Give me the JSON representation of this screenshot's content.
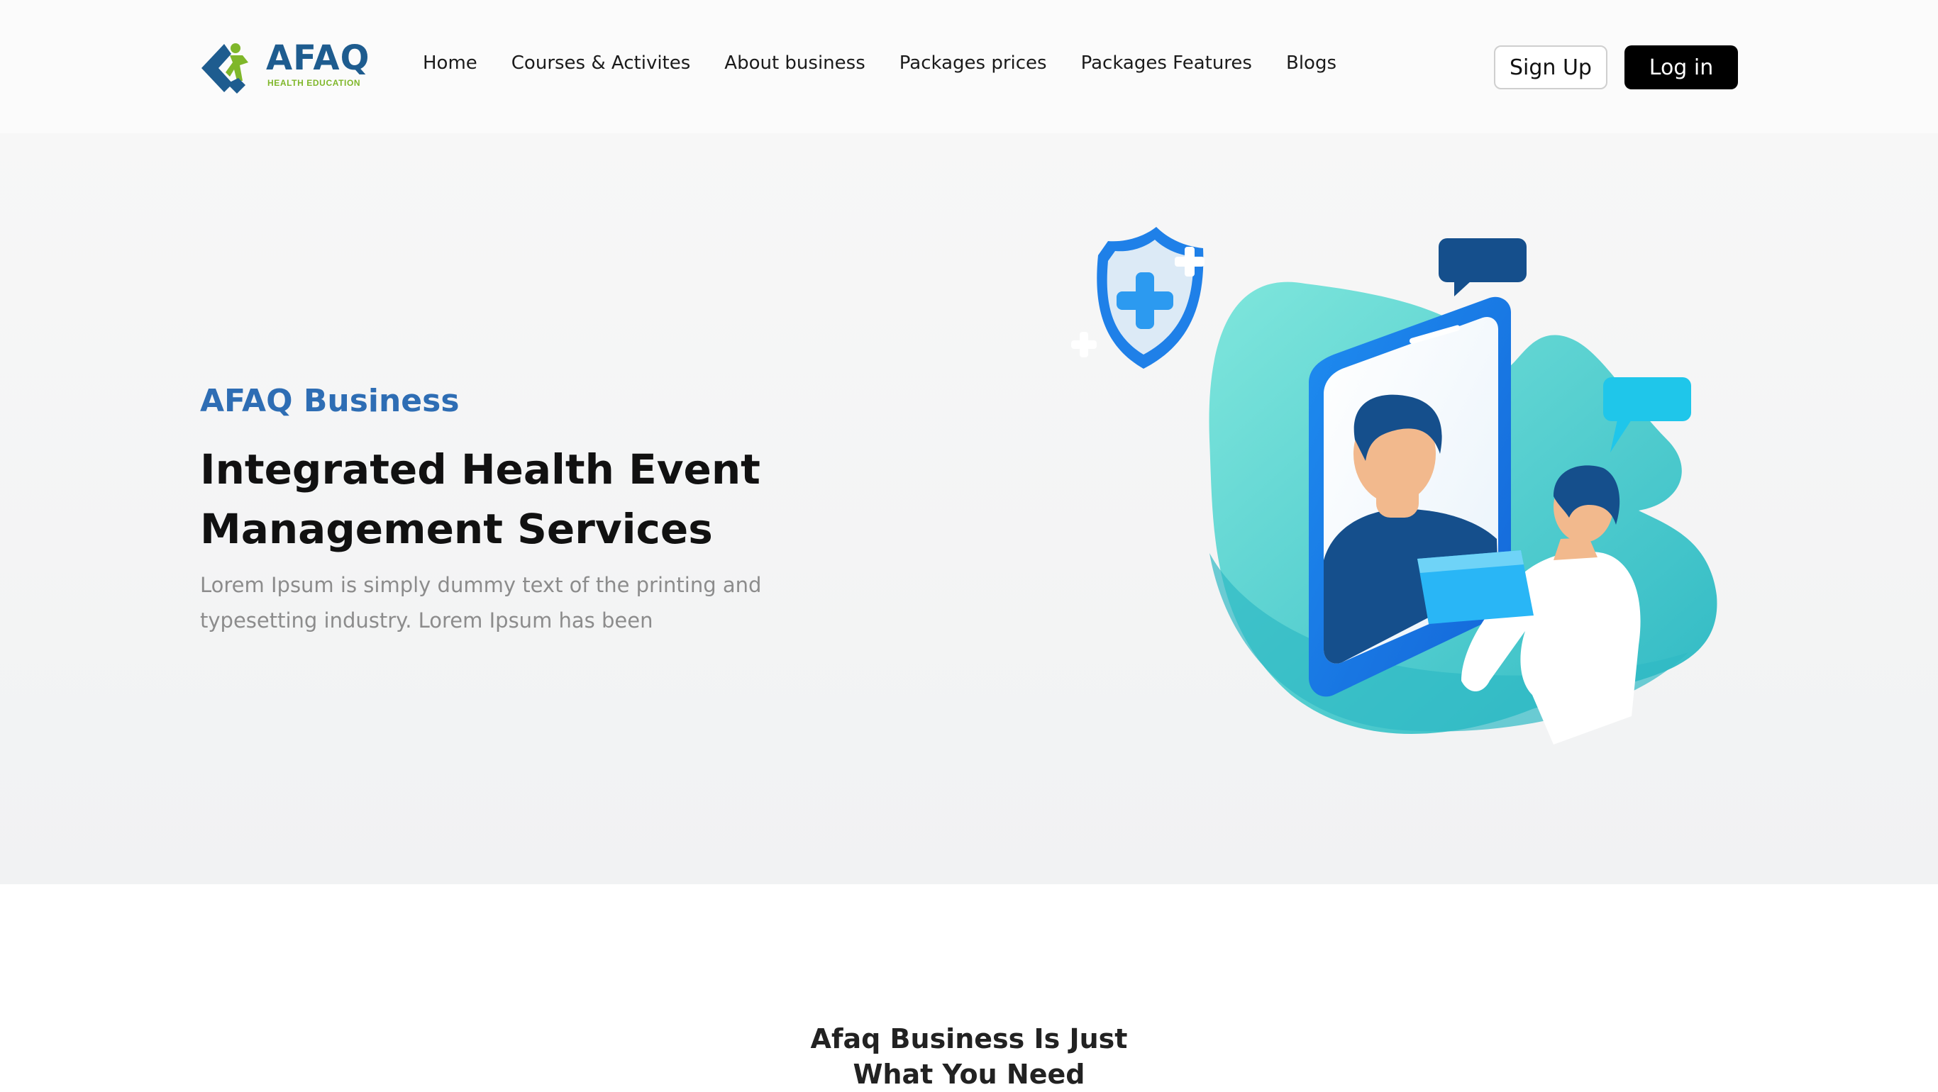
{
  "brand": {
    "name": "AFAQ",
    "tagline": "HEALTH EDUCATION",
    "primary_color": "#1e5c8f",
    "accent_color": "#7fb72a"
  },
  "nav": {
    "items": [
      {
        "label": "Home"
      },
      {
        "label": "Courses & Activites"
      },
      {
        "label": "About business"
      },
      {
        "label": "Packages prices"
      },
      {
        "label": "Packages Features"
      },
      {
        "label": "Blogs"
      }
    ]
  },
  "auth": {
    "signup_label": "Sign Up",
    "login_label": "Log in"
  },
  "hero": {
    "kicker": "AFAQ Business",
    "headline_line1": "Integrated Health Event",
    "headline_line2": "Management Services",
    "lead_line1": "Lorem Ipsum is simply dummy text of the printing and",
    "lead_line2": "typesetting industry. Lorem Ipsum has been",
    "illustration_icons": [
      "shield-plus-icon",
      "phone-icon",
      "chat-bubble-icon",
      "doctor-icon"
    ]
  },
  "section2": {
    "title_line1": "Afaq Business Is Just",
    "title_line2": "What You Need"
  }
}
